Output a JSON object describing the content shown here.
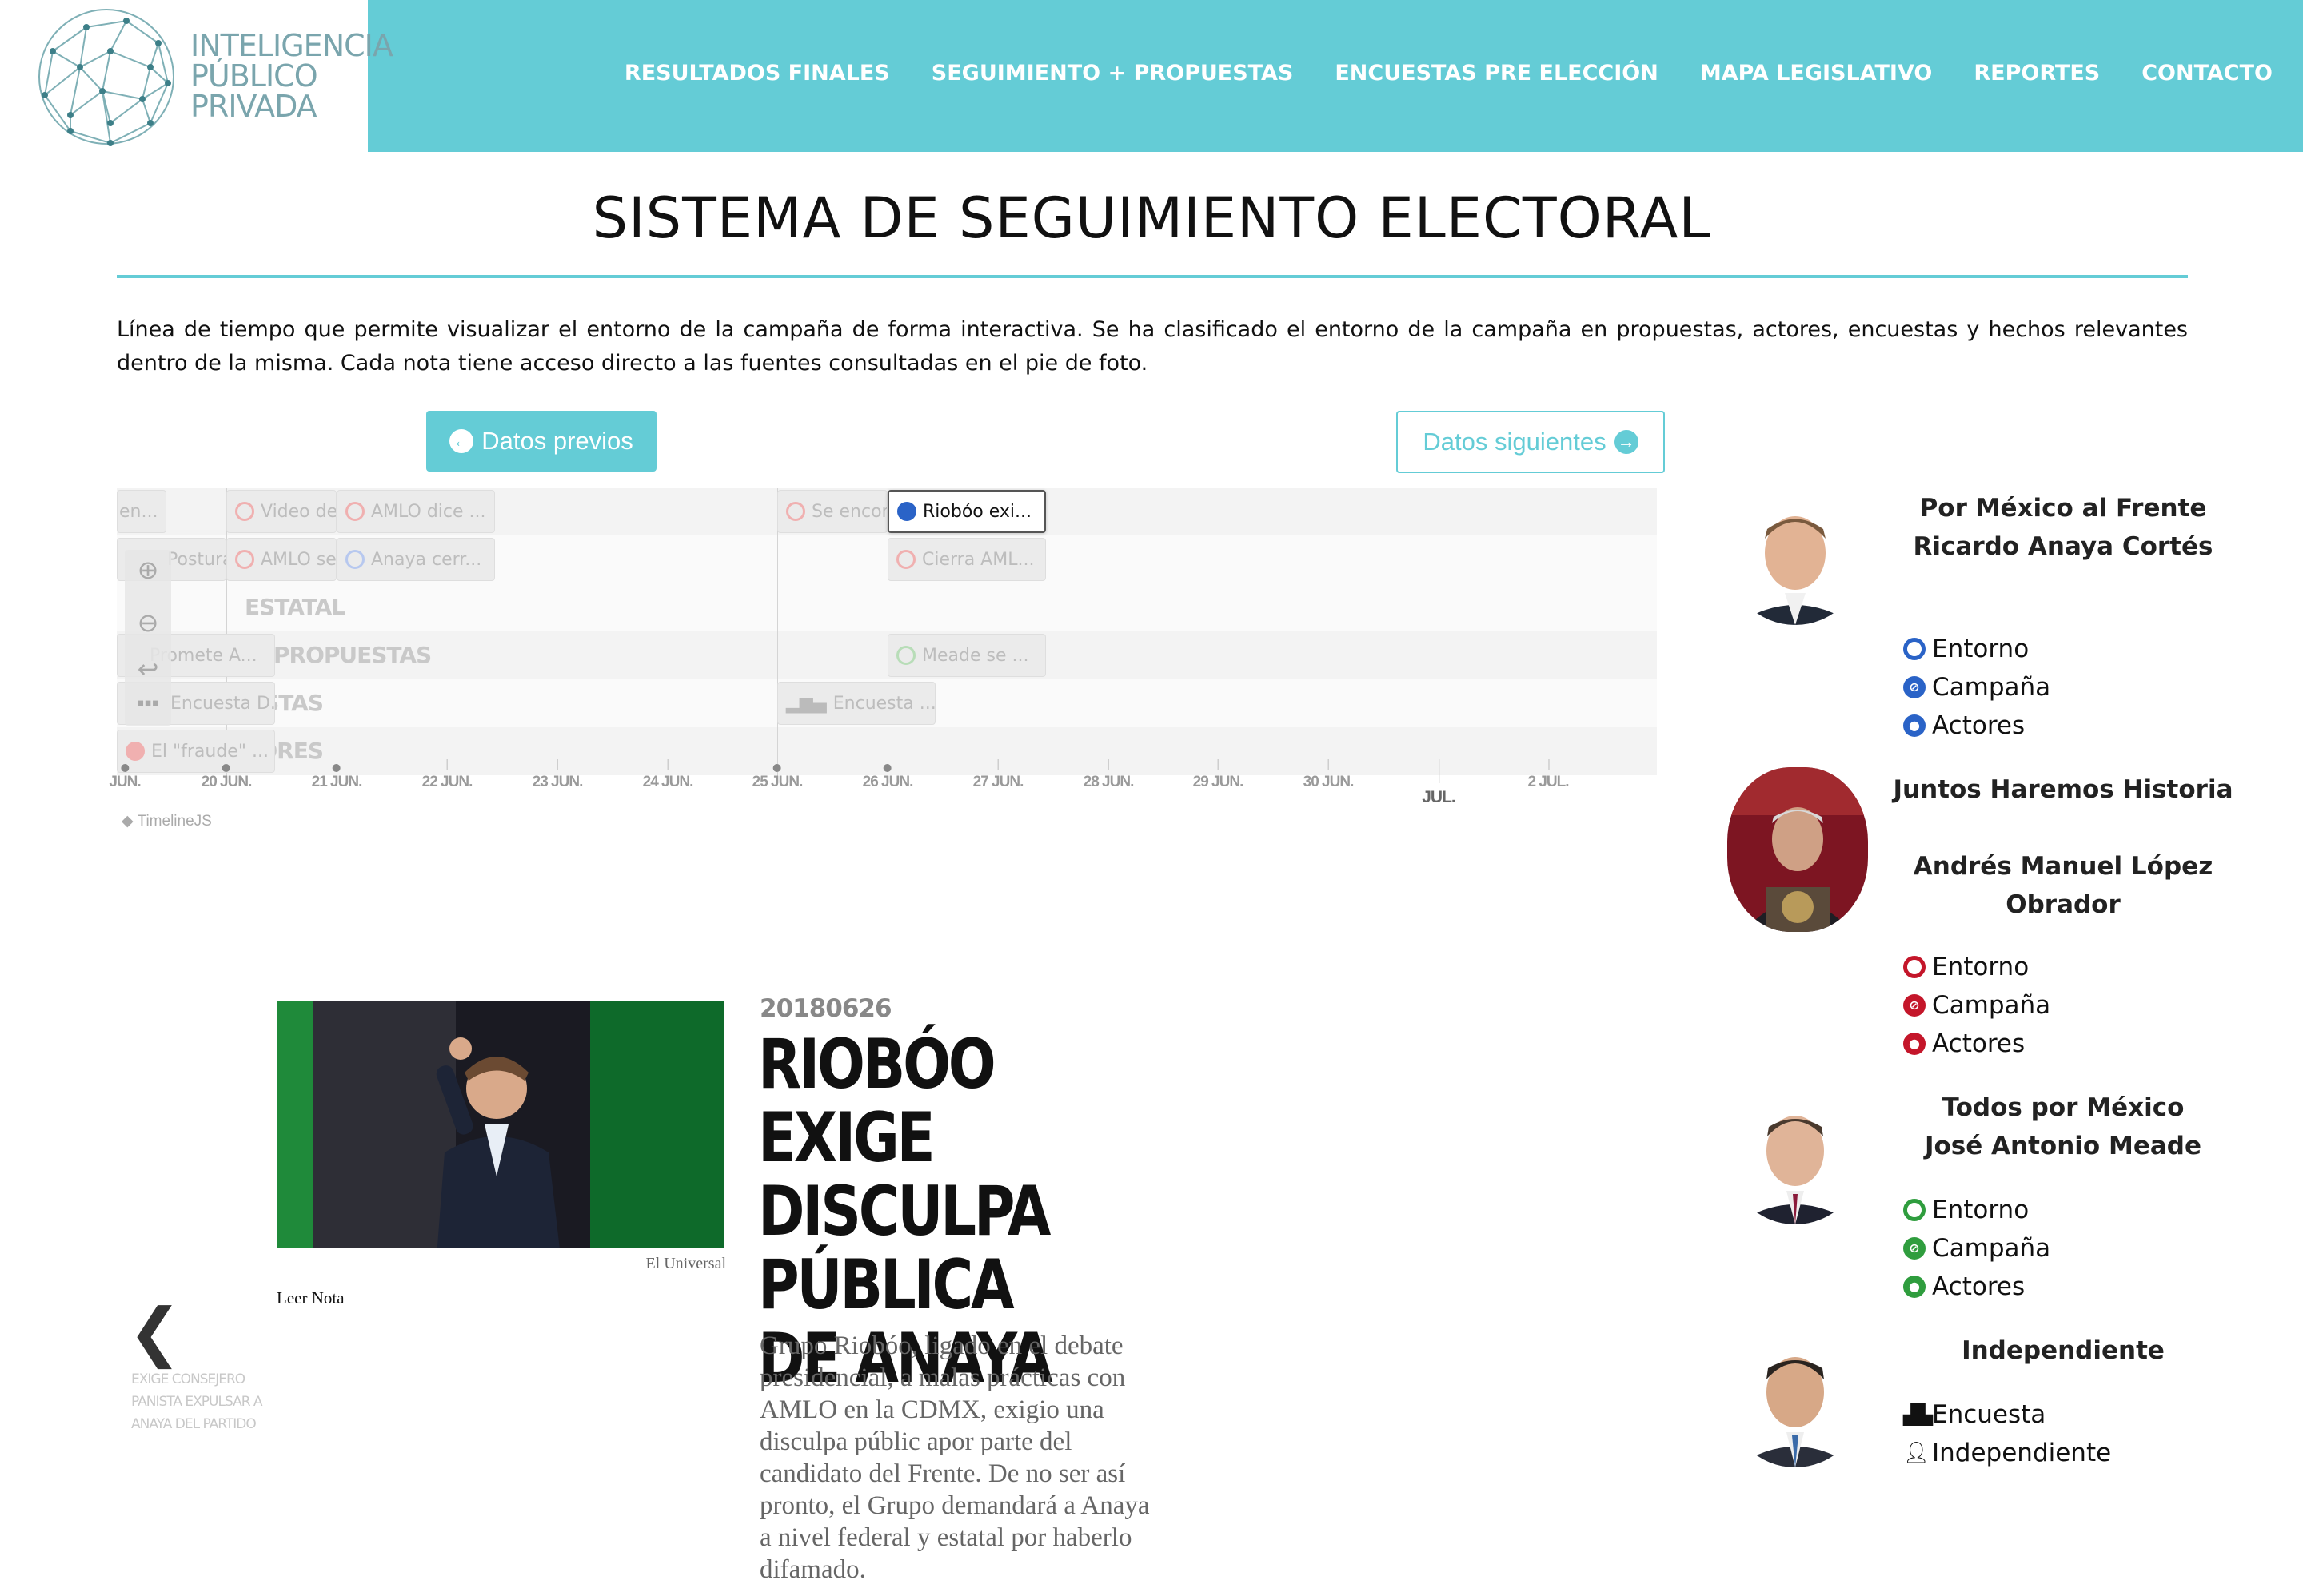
{
  "header": {
    "logo": {
      "line1": "INTELIGENCIA",
      "line2": "PÚBLICO",
      "line3": "PRIVADA"
    },
    "nav": [
      "RESULTADOS FINALES",
      "SEGUIMIENTO + PROPUESTAS",
      "ENCUESTAS PRE ELECCIÓN",
      "MAPA LEGISLATIVO",
      "REPORTES",
      "CONTACTO"
    ],
    "colors": {
      "accent": "#64ccd6"
    }
  },
  "page": {
    "title": "SISTEMA DE SEGUIMIENTO ELECTORAL",
    "intro": "Línea de tiempo que permite visualizar el entorno de la campaña de forma interactiva. Se ha clasificado el entorno de la campaña en propuestas, actores, encuestas y hechos relevantes dentro de la misma. Cada nota tiene acceso directo a las fuentes consultadas en el pie de foto."
  },
  "timeline": {
    "prev_label": "Datos previos",
    "next_label": "Datos siguientes",
    "groups": [
      "ESTATAL",
      "PROPUESTAS",
      "ENCUESTAS",
      "ACTORES"
    ],
    "markers": [
      "en...",
      "Video de",
      "AMLO dice ...",
      "Se encon",
      "Riobóo exi...",
      "Postura",
      "AMLO se",
      "Anaya cerr...",
      "Cierra AML...",
      "Promete A...",
      "Meade se ...",
      "Encuesta D...",
      "Encuesta ...",
      "El \"fraude\" ..."
    ],
    "ticks": [
      "JUN.",
      "20 JUN.",
      "21 JUN.",
      "22 JUN.",
      "23 JUN.",
      "24 JUN.",
      "25 JUN.",
      "26 JUN.",
      "27 JUN.",
      "28 JUN.",
      "29 JUN.",
      "30 JUN.",
      "JUL.",
      "2 JUL."
    ],
    "credit": "TimelineJS"
  },
  "article": {
    "date": "20180626",
    "headline": "RIOBÓO EXIGE DISCULPA PÚBLICA DE ANAYA",
    "body": "Grupo Riobóo, ligado en el debate presidencial, a malas prácticas con AMLO en la CDMX, exigio una disculpa públic apor parte del candidato del Frente. De no ser así pronto, el Grupo demandará a Anaya a nivel federal y estatal por haberlo difamado.",
    "image_credit": "El Universal",
    "read_link": "Leer Nota",
    "prev_title": "EXIGE CONSEJERO PANISTA EXPULSAR A ANAYA DEL PARTIDO"
  },
  "candidates": [
    {
      "coalition": "Por México al Frente",
      "name": "Ricardo Anaya Cortés",
      "color": "#2a63c7",
      "legend": [
        "Entorno",
        "Campaña",
        "Actores"
      ]
    },
    {
      "coalition": "Juntos Haremos Historia",
      "name": "Andrés Manuel López Obrador",
      "color": "#c4162a",
      "legend": [
        "Entorno",
        "Campaña",
        "Actores"
      ]
    },
    {
      "coalition": "Todos por México",
      "name": "José Antonio Meade",
      "color": "#2f9d3e",
      "legend": [
        "Entorno",
        "Campaña",
        "Actores"
      ]
    },
    {
      "coalition": "Independiente",
      "name": "",
      "color": "#111111",
      "legend": [
        "Encuesta",
        "Independiente"
      ]
    }
  ]
}
